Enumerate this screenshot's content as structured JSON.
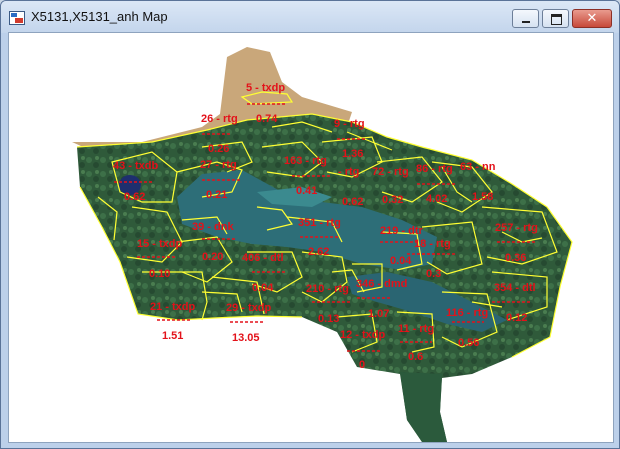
{
  "window": {
    "title": "X5131,X5131_anh Map",
    "close_glyph": "✕"
  },
  "colors": {
    "label_red": "#e3121a",
    "boundary_yellow": "#ffff33",
    "sand": "#c9a77a",
    "forest": "#2f5a3a",
    "water": "#2d6e78"
  },
  "parcels": [
    {
      "name": "5 - txdp",
      "value": ""
    },
    {
      "name": "26 - rtg",
      "value": "0.26"
    },
    {
      "name": "",
      "value": "0.74"
    },
    {
      "name": "9 - rtg",
      "value": "1.36"
    },
    {
      "name": "43 - txdb",
      "value": "0.62"
    },
    {
      "name": "27 - rtg",
      "value": "0.21"
    },
    {
      "name": "163 - rtg",
      "value": "0.41"
    },
    {
      "name": "- rtg",
      "value": "0.62"
    },
    {
      "name": "72 - rtg",
      "value": "0.32"
    },
    {
      "name": "86 - rtg",
      "value": "4.02"
    },
    {
      "name": "63 - nn",
      "value": "1.58"
    },
    {
      "name": "39 - dnk",
      "value": "0.20"
    },
    {
      "name": "351 - rtg",
      "value": "2.62"
    },
    {
      "name": "219 - dtr",
      "value": "0.04"
    },
    {
      "name": "257 - rtg",
      "value": "0.36"
    },
    {
      "name": "15 - txdp",
      "value": "0.10"
    },
    {
      "name": "406 - dtl",
      "value": "0.04"
    },
    {
      "name": "18 - rtg",
      "value": "0.3"
    },
    {
      "name": "210 - rtg",
      "value": "0.13"
    },
    {
      "name": "354 - dtl",
      "value": "0.12"
    },
    {
      "name": "346 - dmd",
      "value": "1.07"
    },
    {
      "name": "21 - txdp",
      "value": "1.51"
    },
    {
      "name": "29 - txdp",
      "value": "13.05"
    },
    {
      "name": "12 - txdp",
      "value": "0"
    },
    {
      "name": "11 - rtg",
      "value": "0.6"
    },
    {
      "name": "116 - rtg",
      "value": "0.56"
    }
  ]
}
